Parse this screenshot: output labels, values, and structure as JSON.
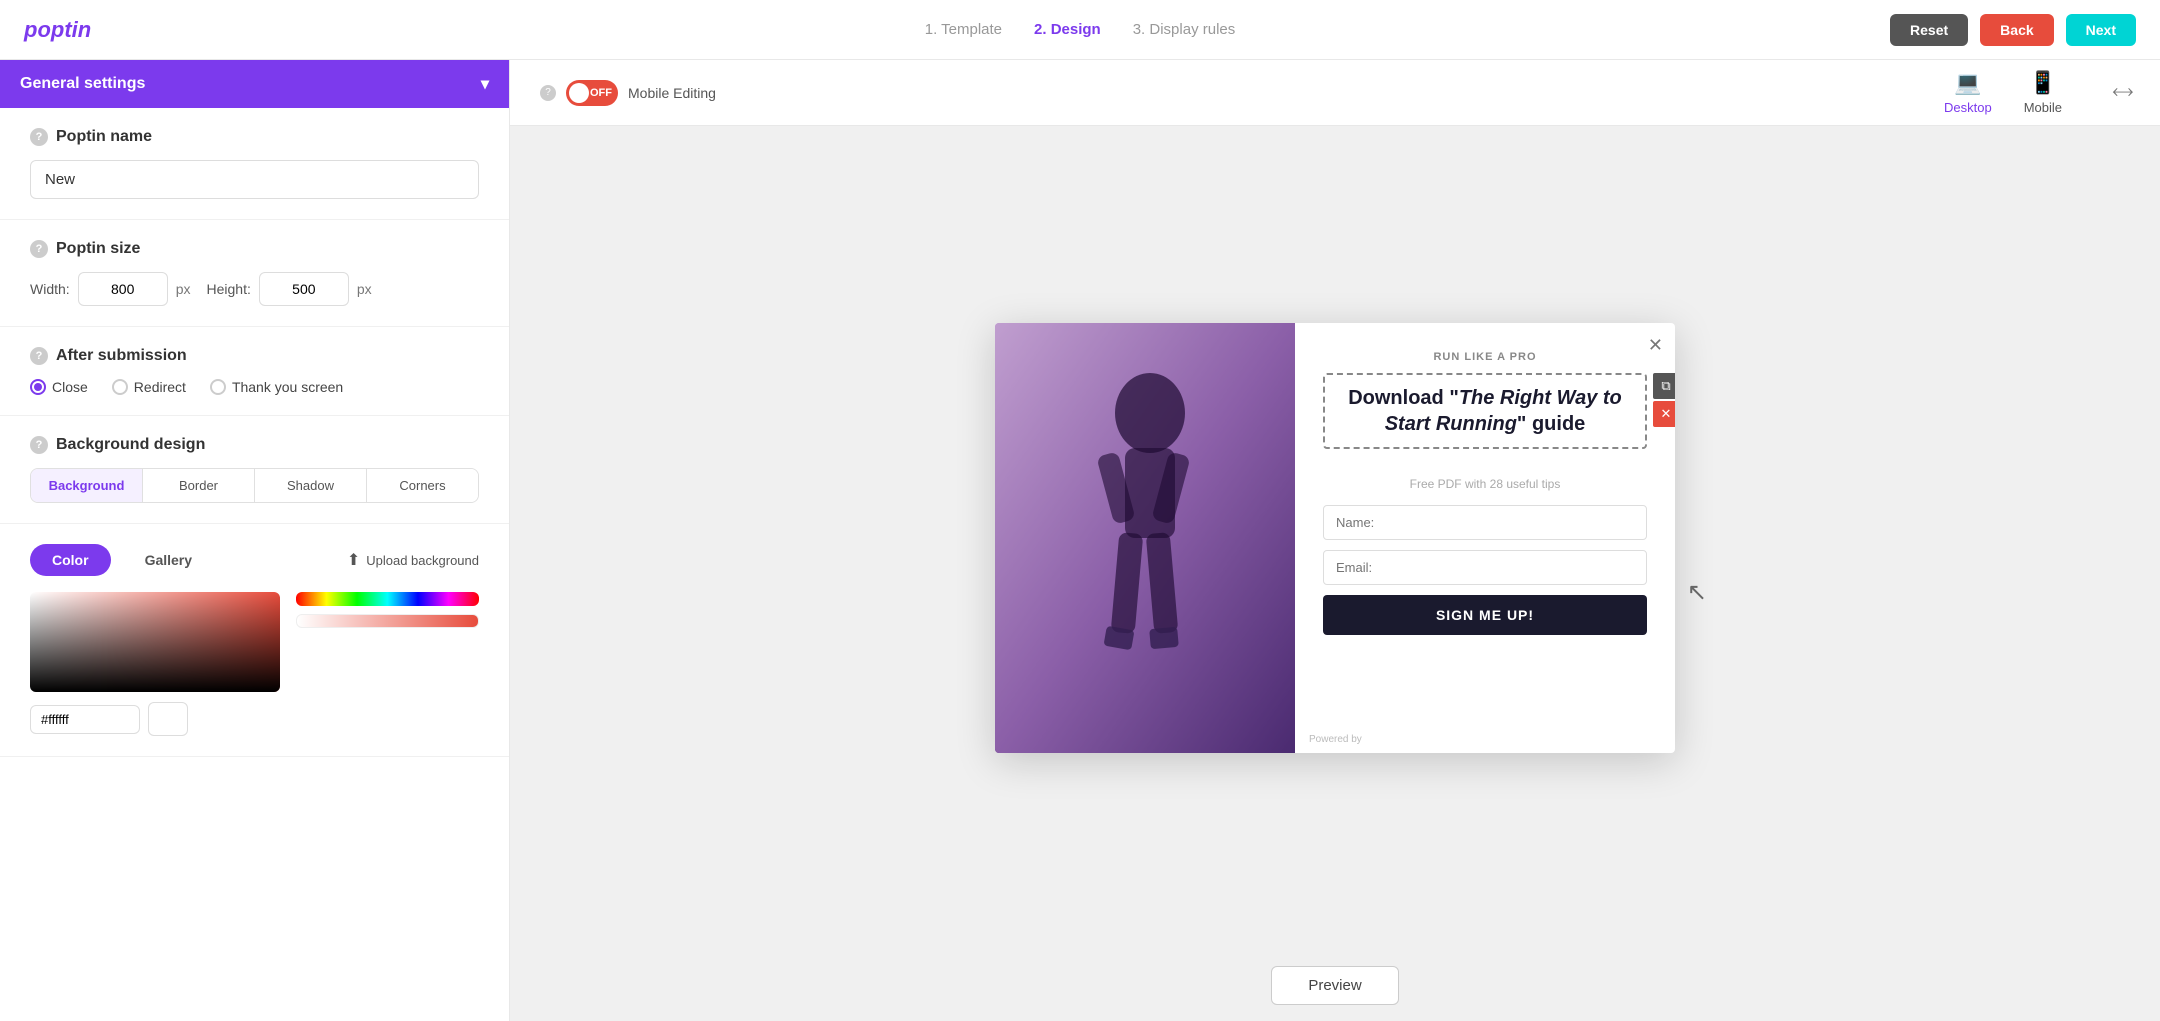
{
  "header": {
    "logo": "poptin",
    "steps": [
      {
        "label": "1. Template",
        "state": "inactive"
      },
      {
        "label": "2. Design",
        "state": "active"
      },
      {
        "label": "3. Display rules",
        "state": "inactive"
      }
    ],
    "buttons": {
      "reset": "Reset",
      "back": "Back",
      "next": "Next"
    }
  },
  "left_panel": {
    "general_settings_title": "General settings",
    "poptin_name": {
      "label": "Poptin name",
      "value": "New"
    },
    "poptin_size": {
      "label": "Poptin size",
      "width_label": "Width:",
      "width_value": "800",
      "width_unit": "px",
      "height_label": "Height:",
      "height_value": "500",
      "height_unit": "px"
    },
    "after_submission": {
      "label": "After submission",
      "options": [
        {
          "label": "Close",
          "selected": true
        },
        {
          "label": "Redirect",
          "selected": false
        },
        {
          "label": "Thank you screen",
          "selected": false
        }
      ]
    },
    "background_design": {
      "label": "Background design",
      "tabs": [
        "Background",
        "Border",
        "Shadow",
        "Corners"
      ],
      "color_tab": "Color",
      "gallery_tab": "Gallery",
      "upload_label": "Upload background",
      "hex_value": "#ffffff"
    }
  },
  "right_panel": {
    "mobile_editing": {
      "toggle_text": "OFF",
      "label": "Mobile Editing"
    },
    "device_tabs": [
      {
        "label": "Desktop",
        "active": true
      },
      {
        "label": "Mobile",
        "active": false
      }
    ],
    "popup": {
      "subtitle": "RUN LIKE A PRO",
      "title_part1": "Download \"",
      "title_italic": "The Right Way to Start Running",
      "title_part2": "\" guide",
      "description": "Free PDF with 28 useful tips",
      "name_placeholder": "Name:",
      "email_placeholder": "Email:",
      "submit_label": "SIGN ME UP!",
      "powered_by": "Powered by"
    },
    "preview_btn": "Preview"
  }
}
